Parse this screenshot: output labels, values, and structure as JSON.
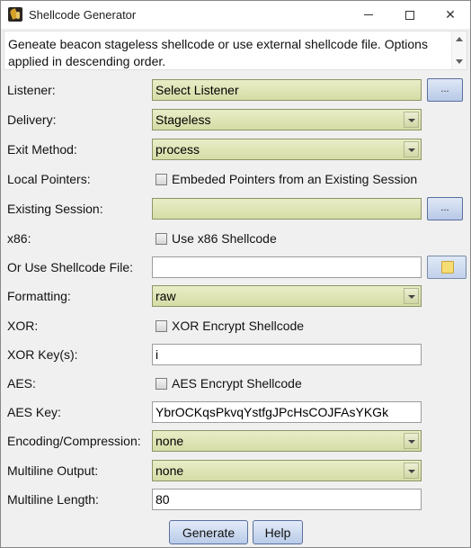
{
  "window": {
    "title": "Shellcode Generator",
    "icon": "app-logo-icon",
    "controls": [
      "minimize-icon",
      "maximize-icon",
      "close-icon"
    ],
    "close_glyph": "✕"
  },
  "description": "Geneate beacon stageless shellcode or use external shellcode file. Options applied in descending order.",
  "form": {
    "listener": {
      "label": "Listener:",
      "value": "Select Listener",
      "button": "..."
    },
    "delivery": {
      "label": "Delivery:",
      "value": "Stageless"
    },
    "exit_method": {
      "label": "Exit Method:",
      "value": "process"
    },
    "local_pointers": {
      "label": "Local Pointers:",
      "checkbox": "Embeded Pointers from an Existing Session",
      "checked": false
    },
    "existing_session": {
      "label": "Existing Session:",
      "value": "",
      "button": "..."
    },
    "x86": {
      "label": "x86:",
      "checkbox": "Use x86 Shellcode",
      "checked": false
    },
    "shellcode_file": {
      "label": "Or Use Shellcode File:",
      "value": "",
      "icon": "folder-icon"
    },
    "formatting": {
      "label": "Formatting:",
      "value": "raw"
    },
    "xor": {
      "label": "XOR:",
      "checkbox": "XOR Encrypt Shellcode",
      "checked": false
    },
    "xor_keys": {
      "label": "XOR Key(s):",
      "value": "i"
    },
    "aes": {
      "label": "AES:",
      "checkbox": "AES Encrypt Shellcode",
      "checked": false
    },
    "aes_key": {
      "label": "AES Key:",
      "value": "YbrOCKqsPkvqYstfgJPcHsCOJFAsYKGk"
    },
    "encoding": {
      "label": "Encoding/Compression:",
      "value": "none"
    },
    "multiline_output": {
      "label": "Multiline Output:",
      "value": "none"
    },
    "multiline_length": {
      "label": "Multiline Length:",
      "value": "80"
    }
  },
  "buttons": {
    "generate": "Generate",
    "help": "Help"
  },
  "colors": {
    "combo_fill": "#dfe4b8",
    "button_fill": "#c6d5ee",
    "window_bg": "#f0f0f0"
  }
}
